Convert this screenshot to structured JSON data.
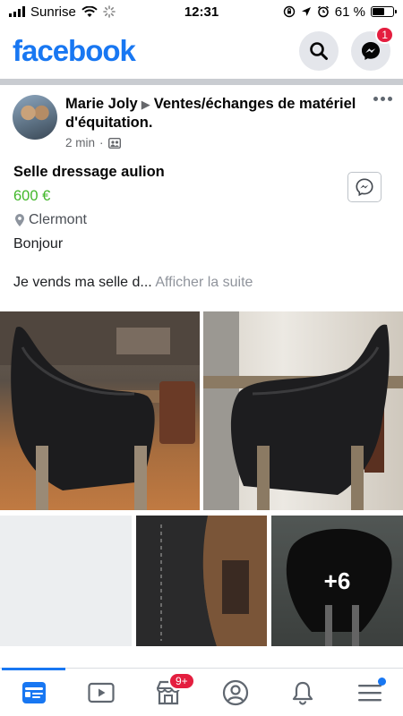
{
  "status_bar": {
    "carrier": "Sunrise",
    "time": "12:31",
    "battery": "61 %",
    "battery_level": 0.61
  },
  "header": {
    "logo": "facebook",
    "messenger_badge": "1"
  },
  "post": {
    "author": "Marie Joly",
    "group": "Ventes/échanges de matériel d'équitation.",
    "time": "2 min",
    "separator": "·"
  },
  "listing": {
    "title": "Selle dressage aulion",
    "price": "600 €",
    "location": "Clermont"
  },
  "body": {
    "line1": "Bonjour",
    "line2": "Je vends ma selle d...",
    "see_more": "Afficher la suite"
  },
  "photos": {
    "more_count": "+6"
  },
  "bottom_nav": {
    "marketplace_badge": "9+"
  },
  "colors": {
    "brand": "#1877f2",
    "price": "#42b72a",
    "badge": "#e41e3f"
  }
}
